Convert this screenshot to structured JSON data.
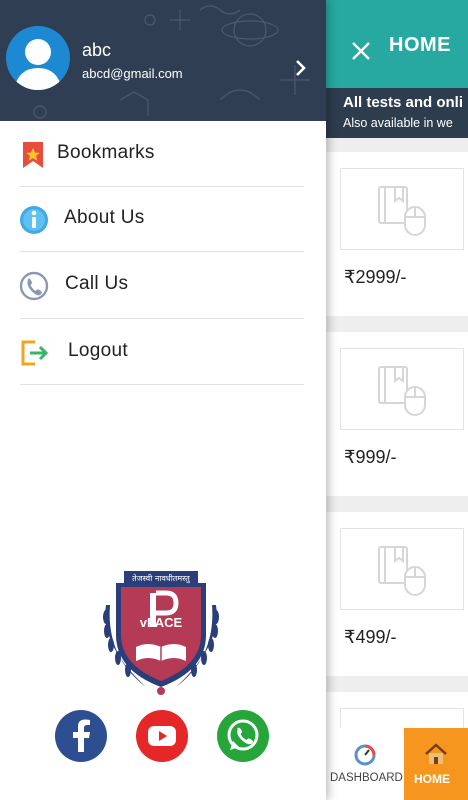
{
  "app": {
    "title": "HOME",
    "banner": {
      "line1": "All tests and onli",
      "line2": "Also available in we"
    },
    "cards": [
      {
        "price": "₹2999/-"
      },
      {
        "price": "₹999/-"
      },
      {
        "price": "₹499/-"
      }
    ],
    "bottom_nav": {
      "dashboard_label": "DASHBOARD",
      "home_label": "HOME"
    }
  },
  "drawer": {
    "user": {
      "name": "abc",
      "email": "abcd@gmail.com"
    },
    "menu": [
      {
        "label": "Bookmarks",
        "icon": "bookmark-icon"
      },
      {
        "label": "About Us",
        "icon": "info-icon"
      },
      {
        "label": "Call Us",
        "icon": "phone-icon"
      },
      {
        "label": "Logout",
        "icon": "logout-icon"
      }
    ],
    "logo": {
      "name": "vPACE",
      "tagline": "तेजस्वी नावधीतमस्तु"
    },
    "social": [
      {
        "name": "facebook-icon",
        "color": "#2d4f91"
      },
      {
        "name": "youtube-icon",
        "color": "#e52727"
      },
      {
        "name": "whatsapp-icon",
        "color": "#25a53a"
      }
    ]
  },
  "colors": {
    "teal": "#27a9a1",
    "drawer_header": "#2f3e52",
    "accent_orange": "#f7961f",
    "logo_maroon": "#b53a55"
  }
}
